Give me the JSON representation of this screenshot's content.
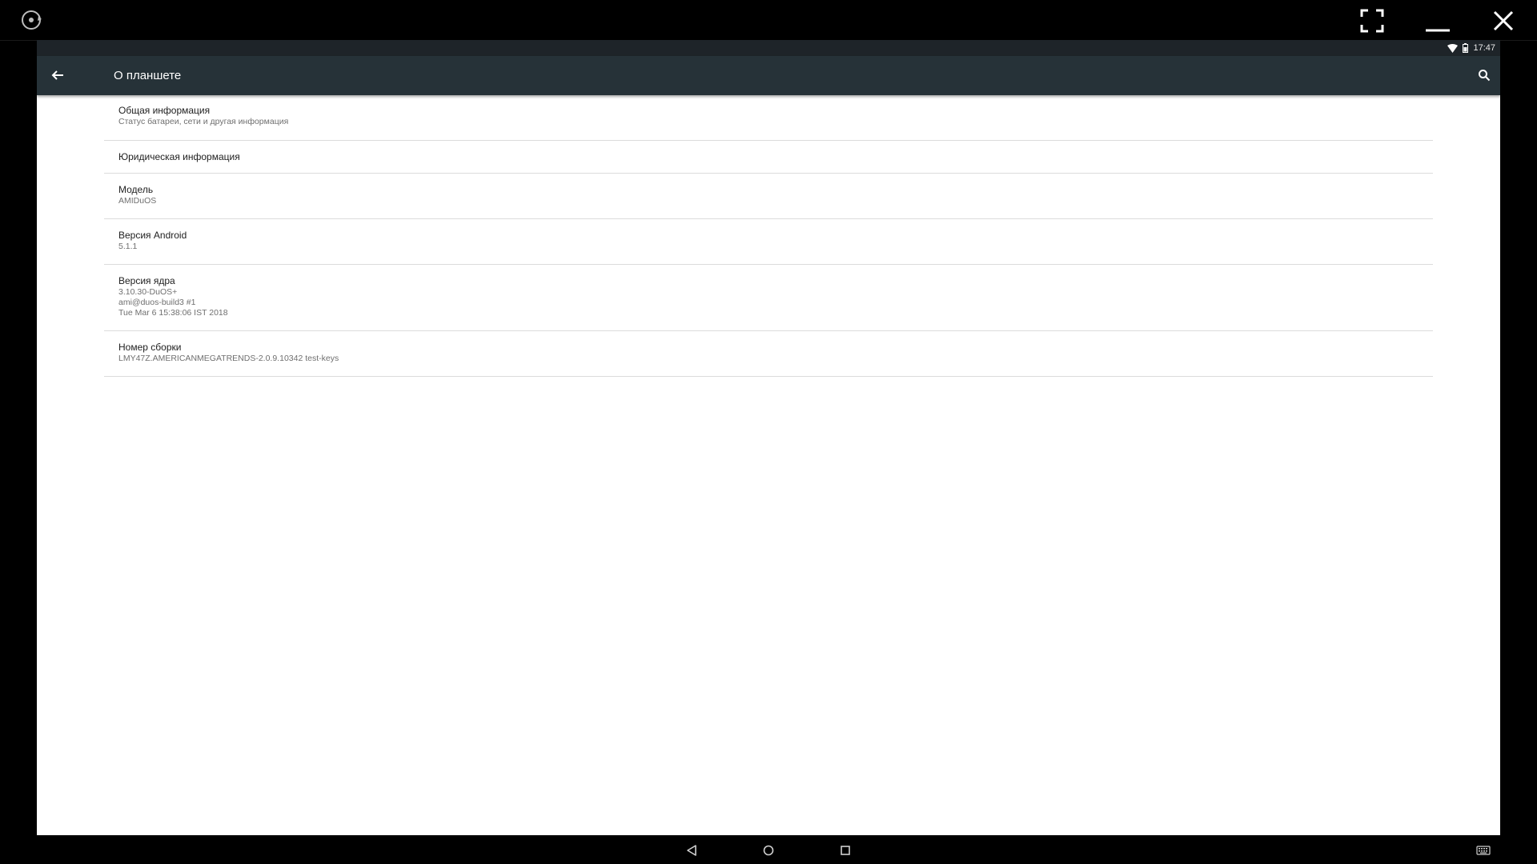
{
  "status_bar": {
    "time": "17:47",
    "wifi_icon": "wifi-icon",
    "battery_icon": "battery-icon"
  },
  "app_bar": {
    "title": "О планшете",
    "back_icon": "arrow-back-icon",
    "search_icon": "search-icon"
  },
  "settings": [
    {
      "title": "Общая информация",
      "summary": "Статус батареи, сети и другая информация"
    },
    {
      "title": "Юридическая информация",
      "summary": ""
    },
    {
      "title": "Модель",
      "summary": "AMIDuOS"
    },
    {
      "title": "Версия Android",
      "summary": "5.1.1"
    },
    {
      "title": "Версия ядра",
      "summary": "3.10.30-DuOS+\nami@duos-build3 #1\nTue Mar 6 15:38:06 IST 2018"
    },
    {
      "title": "Номер сборки",
      "summary": "LMY47Z.AMERICANMEGATRENDS-2.0.9.10342 test-keys"
    }
  ],
  "colors": {
    "app_bar": "#263238",
    "status_bar": "#1e2429",
    "background": "#ffffff",
    "divider": "#dcdcdc"
  }
}
